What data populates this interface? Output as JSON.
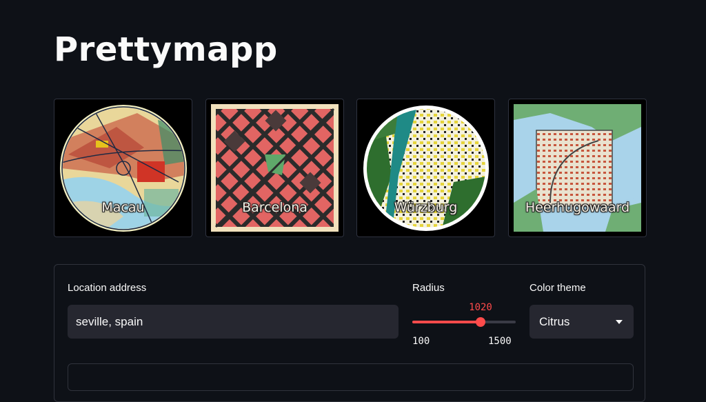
{
  "app": {
    "title": "Prettymapp"
  },
  "gallery": [
    {
      "name": "Macau"
    },
    {
      "name": "Barcelona"
    },
    {
      "name": "Würzburg"
    },
    {
      "name": "Heerhugowaard"
    }
  ],
  "form": {
    "address_label": "Location address",
    "address_value": "seville, spain",
    "radius_label": "Radius",
    "radius_value": 1020,
    "radius_display": "1020",
    "radius_min": 100,
    "radius_min_label": "100",
    "radius_max": 1500,
    "radius_max_label": "1500",
    "color_theme_label": "Color theme",
    "color_theme_value": "Citrus"
  },
  "colors": {
    "background": "#0e1117",
    "accent": "#ff4b4b",
    "input_bg": "#262730"
  },
  "icons": {
    "select_chevron": "chevron-down-icon"
  }
}
